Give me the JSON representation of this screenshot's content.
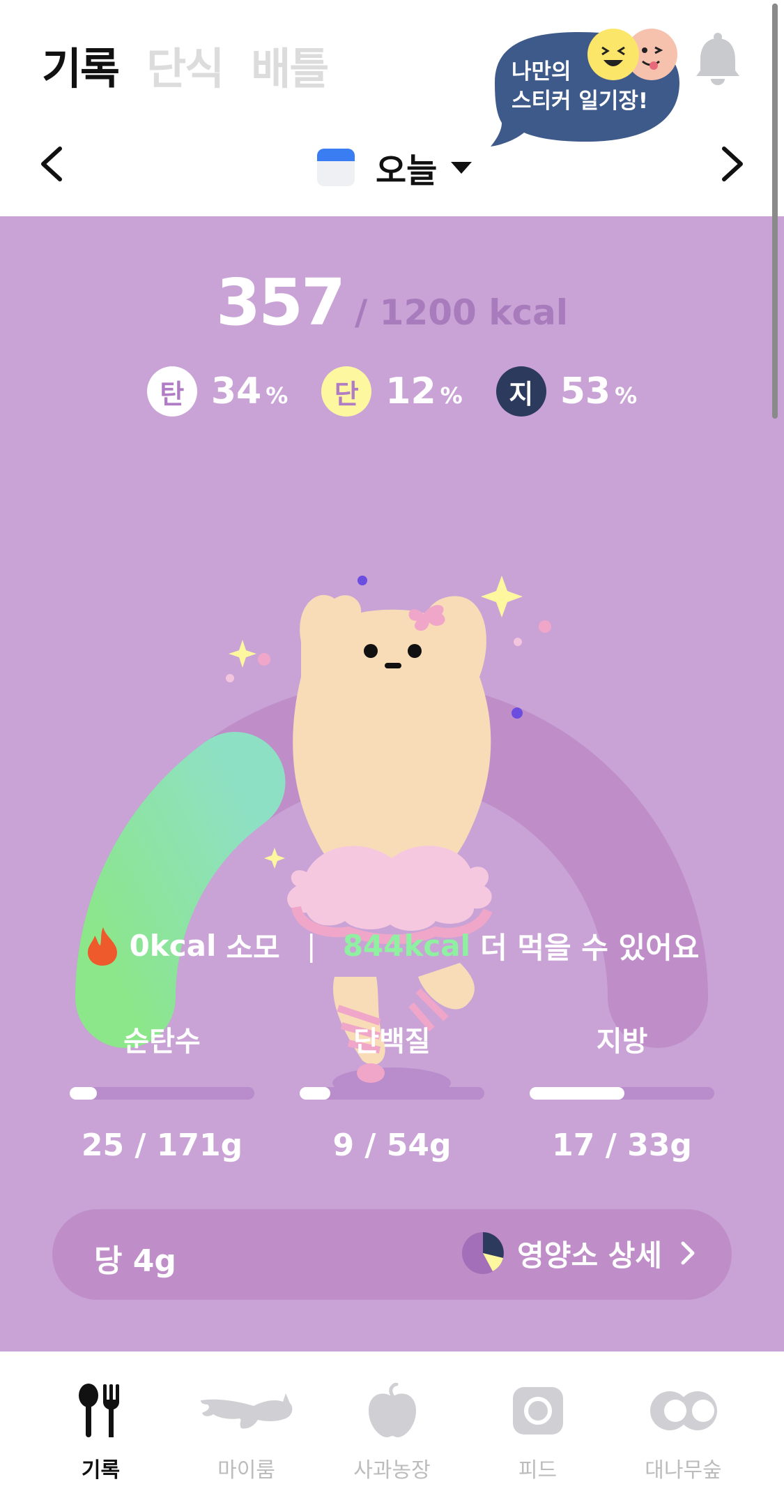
{
  "header": {
    "tabs": [
      {
        "label": "기록",
        "active": true
      },
      {
        "label": "단식",
        "active": false
      },
      {
        "label": "배틀",
        "active": false
      }
    ],
    "promo": {
      "line1": "나만의",
      "line2": "스티커 일기장!"
    },
    "icons": {
      "bell": "bell-icon",
      "prev": "chevron-left-icon",
      "next": "chevron-right-icon",
      "calendar": "calendar-icon"
    },
    "date_label": "오늘"
  },
  "summary": {
    "kcal_now": "357",
    "kcal_goal": "/ 1200 kcal",
    "macros": [
      {
        "badge": "탄",
        "value": "34",
        "unit": "%",
        "badge_color": "#ffffff",
        "text_color": "#b07cc4"
      },
      {
        "badge": "단",
        "value": "12",
        "unit": "%",
        "badge_color": "#fdf7a0",
        "text_color": "#b07cc4"
      },
      {
        "badge": "지",
        "value": "53",
        "unit": "%",
        "badge_color": "#2c3a5e",
        "text_color": "#ffffff"
      }
    ],
    "gauge_progress": 0.3
  },
  "burn": {
    "burned": "0kcal",
    "burned_suffix": "소모",
    "separator": "|",
    "remaining": "844kcal",
    "remaining_suffix": "더 먹을 수 있어요"
  },
  "nutrients": [
    {
      "label": "순탄수",
      "value": "25 / 171g",
      "progress": 0.146
    },
    {
      "label": "단백질",
      "value": "9 / 54g",
      "progress": 0.167
    },
    {
      "label": "지방",
      "value": "17 / 33g",
      "progress": 0.515
    }
  ],
  "detail": {
    "sugar": "당 4g",
    "link": "영양소 상세"
  },
  "bottom_nav": [
    {
      "label": "기록",
      "icon": "spoon-fork-icon",
      "active": true
    },
    {
      "label": "마이룸",
      "icon": "cat-icon",
      "active": false
    },
    {
      "label": "사과농장",
      "icon": "apple-icon",
      "active": false
    },
    {
      "label": "피드",
      "icon": "camera-icon",
      "active": false
    },
    {
      "label": "대나무숲",
      "icon": "eyes-icon",
      "active": false
    }
  ],
  "colors": {
    "main_bg": "#c9a3d6",
    "gauge_track": "#bf8ec9",
    "gauge_fill_start": "#8ce68a",
    "gauge_fill_end": "#8ee0c4",
    "promo_bg": "#3e5a8a",
    "accent_green": "#8ef0a0"
  }
}
